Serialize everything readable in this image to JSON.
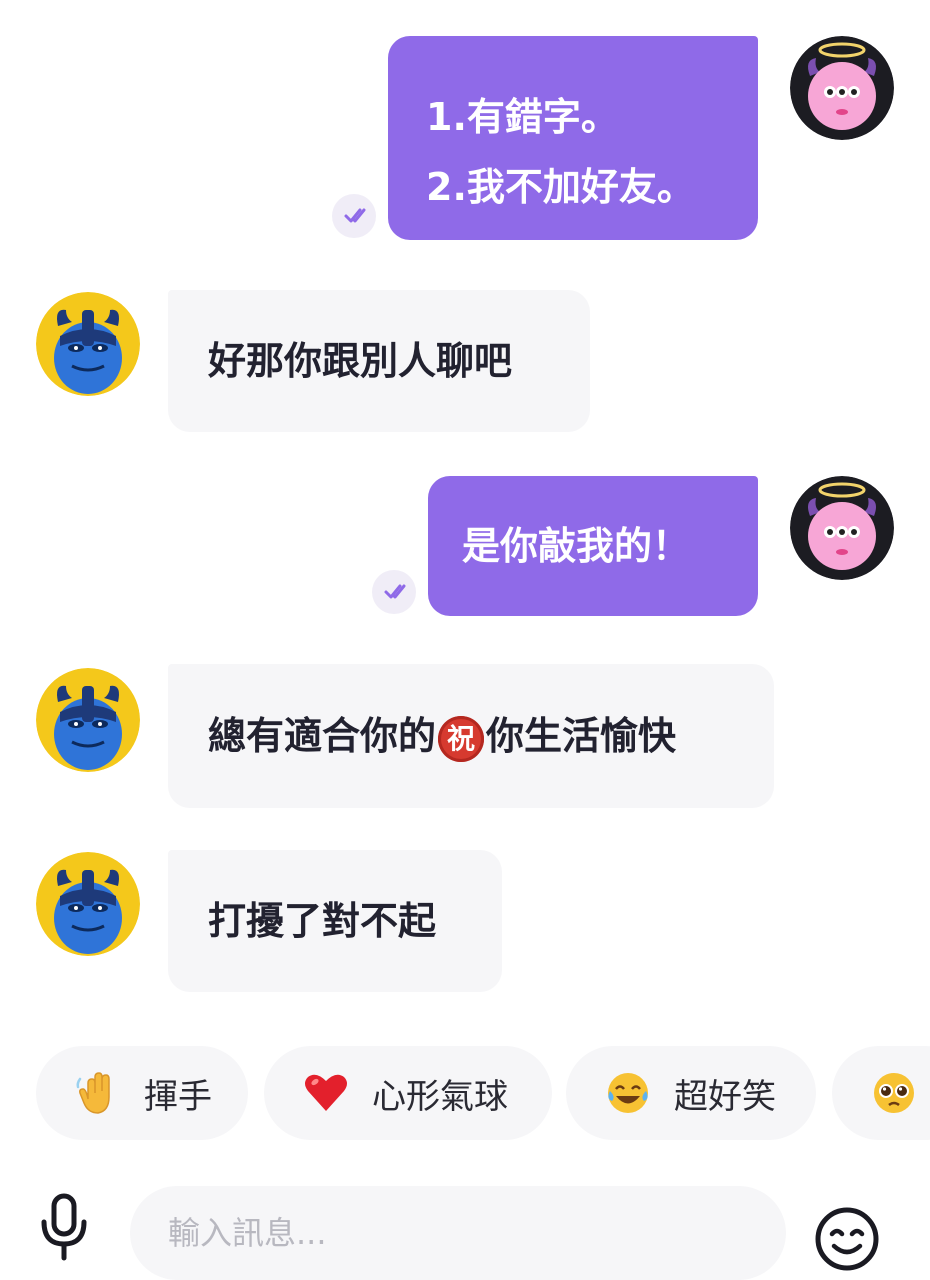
{
  "conversation": {
    "messages": [
      {
        "sender": "self",
        "lines": [
          "1.有錯字。",
          "2.我不加好友。"
        ],
        "read": true
      },
      {
        "sender": "other",
        "lines": [
          "好那你跟別人聊吧"
        ]
      },
      {
        "sender": "self",
        "lines": [
          "是你敲我的！"
        ],
        "read": true
      },
      {
        "sender": "other",
        "text_before": "總有適合你的",
        "badge": "祝",
        "text_after": "你生活愉快"
      },
      {
        "sender": "other",
        "lines": [
          "打擾了對不起"
        ]
      }
    ]
  },
  "quick_reactions": [
    {
      "icon": "waving-hand-emoji",
      "label": "揮手"
    },
    {
      "icon": "red-heart-emoji",
      "label": "心形氣球"
    },
    {
      "icon": "tears-of-joy-emoji",
      "label": "超好笑"
    },
    {
      "icon": "pleading-face-emoji",
      "label": ""
    }
  ],
  "composer": {
    "placeholder": "輸入訊息...",
    "mic_icon": "microphone-icon",
    "emoji_icon": "smiley-face-icon"
  },
  "colors": {
    "outgoing_bubble": "#8f6ae8",
    "incoming_bubble": "#f6f6f8",
    "self_avatar_bg": "#1c1c22",
    "other_avatar_bg": "#f4c81b"
  }
}
